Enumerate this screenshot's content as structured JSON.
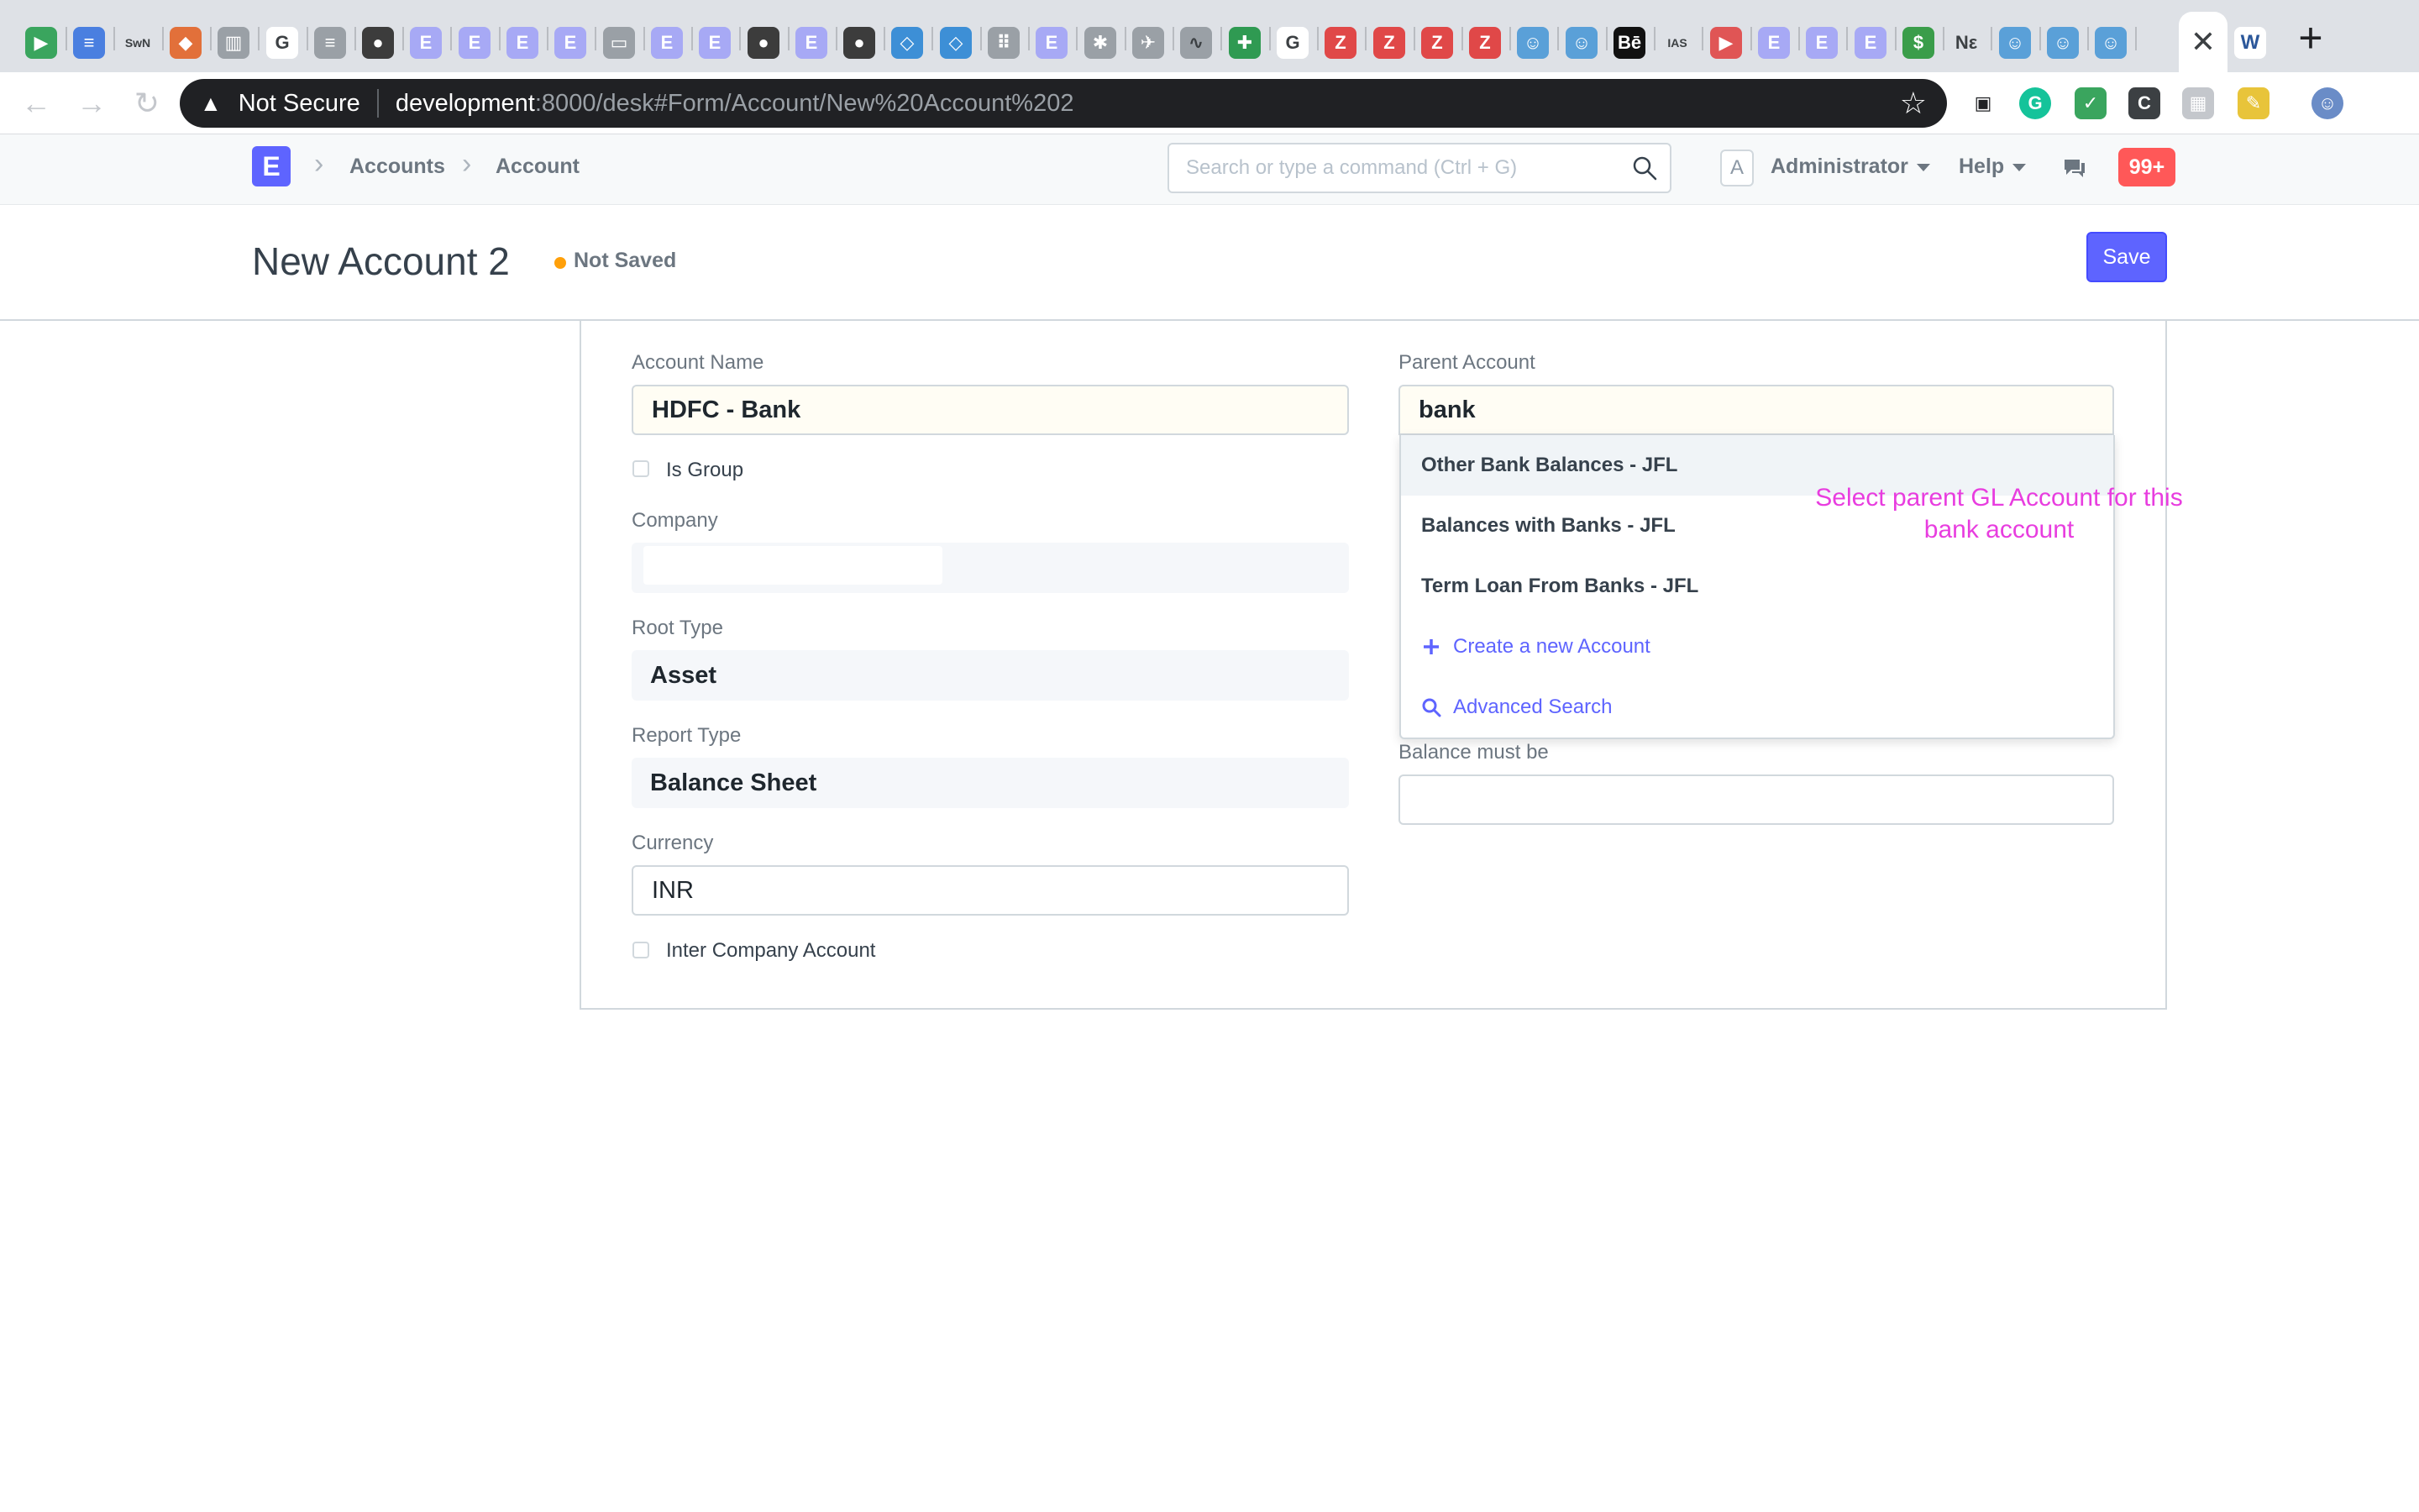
{
  "browser": {
    "tab_icons": [
      "play-store-icon",
      "google-docs-icon",
      "swn-icon",
      "gitlab-icon",
      "reader-icon",
      "google-icon",
      "doc-icon",
      "github-icon",
      "erpnext-icon",
      "erpnext-icon",
      "erpnext-icon",
      "erpnext-icon",
      "bank-icon",
      "erpnext-icon",
      "erpnext-icon",
      "github-icon",
      "erpnext-icon",
      "github-icon",
      "vscode-icon",
      "vscode-icon",
      "dots-icon",
      "erpnext-icon",
      "puzzle-icon",
      "paper-plane-icon",
      "chart-icon",
      "sheets-icon",
      "google-icon",
      "zotero-icon",
      "zotero-icon",
      "zotero-icon",
      "zotero-icon",
      "people-icon",
      "people-icon",
      "behance-icon",
      "ias-icon",
      "youtube-icon",
      "erpnext-icon",
      "erpnext-icon",
      "erpnext-icon",
      "money-icon",
      "ne-icon",
      "people-icon",
      "people-icon",
      "people-icon"
    ],
    "tab_glyphs": [
      "▶",
      "≡",
      "SwN",
      "◆",
      "▥",
      "G",
      "≡",
      "●",
      "E",
      "E",
      "E",
      "E",
      "▭",
      "E",
      "E",
      "●",
      "E",
      "●",
      "◇",
      "◇",
      "⠿",
      "E",
      "✱",
      "✈",
      "∿",
      "✚",
      "G",
      "Z",
      "Z",
      "Z",
      "Z",
      "☺",
      "☺",
      "Bē",
      "IAS",
      "▶",
      "E",
      "E",
      "E",
      "$",
      "Nε",
      "☺",
      "☺",
      "☺"
    ],
    "active_tab_icon": "close-icon",
    "security_label": "Not Secure",
    "url_host": "development",
    "url_path": ":8000/desk#Form/Account/New%20Account%202",
    "extensions": [
      "picture-in-picture-icon",
      "grammarly-icon",
      "shield-check-icon",
      "code-icon",
      "grid-icon",
      "broom-icon",
      "profile-icon"
    ]
  },
  "navbar": {
    "logo_letter": "E",
    "breadcrumbs": [
      "Accounts",
      "Account"
    ],
    "search_placeholder": "Search or type a command (Ctrl + G)",
    "avatar_letter": "A",
    "user_label": "Administrator",
    "help_label": "Help",
    "notification_count": "99+"
  },
  "page": {
    "title": "New Account 2",
    "status": "Not Saved",
    "save_label": "Save"
  },
  "form": {
    "account_name": {
      "label": "Account Name",
      "value": "HDFC - Bank"
    },
    "is_group": {
      "label": "Is Group"
    },
    "company": {
      "label": "Company",
      "value": ""
    },
    "root_type": {
      "label": "Root Type",
      "value": "Asset"
    },
    "report_type": {
      "label": "Report Type",
      "value": "Balance Sheet"
    },
    "currency": {
      "label": "Currency",
      "value": "INR"
    },
    "inter_company": {
      "label": "Inter Company Account"
    },
    "parent_account": {
      "label": "Parent Account",
      "value": "bank"
    },
    "balance_must_be": {
      "label": "Balance must be",
      "value": ""
    }
  },
  "dropdown": {
    "options": [
      "Other Bank Balances - JFL",
      "Balances with Banks - JFL",
      "Term Loan From Banks - JFL"
    ],
    "create_label": "Create a new Account",
    "search_label": "Advanced Search"
  },
  "annotation": "Select parent GL Account for this bank account",
  "colors": {
    "primary": "#5e64ff",
    "notification": "#ff5858",
    "not_saved_dot": "#ffa00a",
    "annotation": "#e83ddf"
  }
}
